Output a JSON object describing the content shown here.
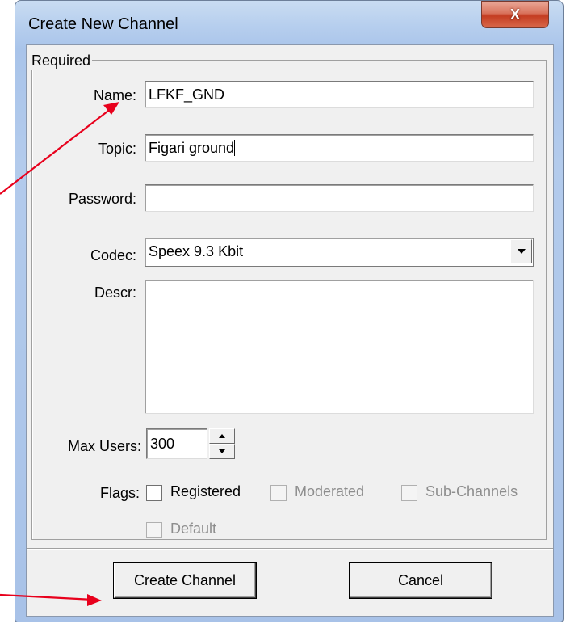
{
  "window": {
    "title": "Create New Channel",
    "close_glyph": "X"
  },
  "group": {
    "legend": "Required"
  },
  "form": {
    "name_label": "Name:",
    "name_value": "LFKF_GND",
    "topic_label": "Topic:",
    "topic_value": "Figari ground",
    "password_label": "Password:",
    "password_value": "",
    "codec_label": "Codec:",
    "codec_value": "Speex 9.3 Kbit",
    "descr_label": "Descr:",
    "descr_value": "",
    "max_users_label": "Max Users:",
    "max_users_value": "300",
    "flags_label": "Flags:",
    "flags": [
      {
        "label": "Registered",
        "checked": false,
        "enabled": true
      },
      {
        "label": "Moderated",
        "checked": false,
        "enabled": false
      },
      {
        "label": "Sub-Channels",
        "checked": false,
        "enabled": false
      },
      {
        "label": "Default",
        "checked": false,
        "enabled": false
      }
    ]
  },
  "buttons": {
    "create_label": "Create Channel",
    "cancel_label": "Cancel"
  },
  "colors": {
    "annotation_arrow": "#e8001c",
    "title_bar": "#b7cfee",
    "close_button": "#c43d22"
  }
}
